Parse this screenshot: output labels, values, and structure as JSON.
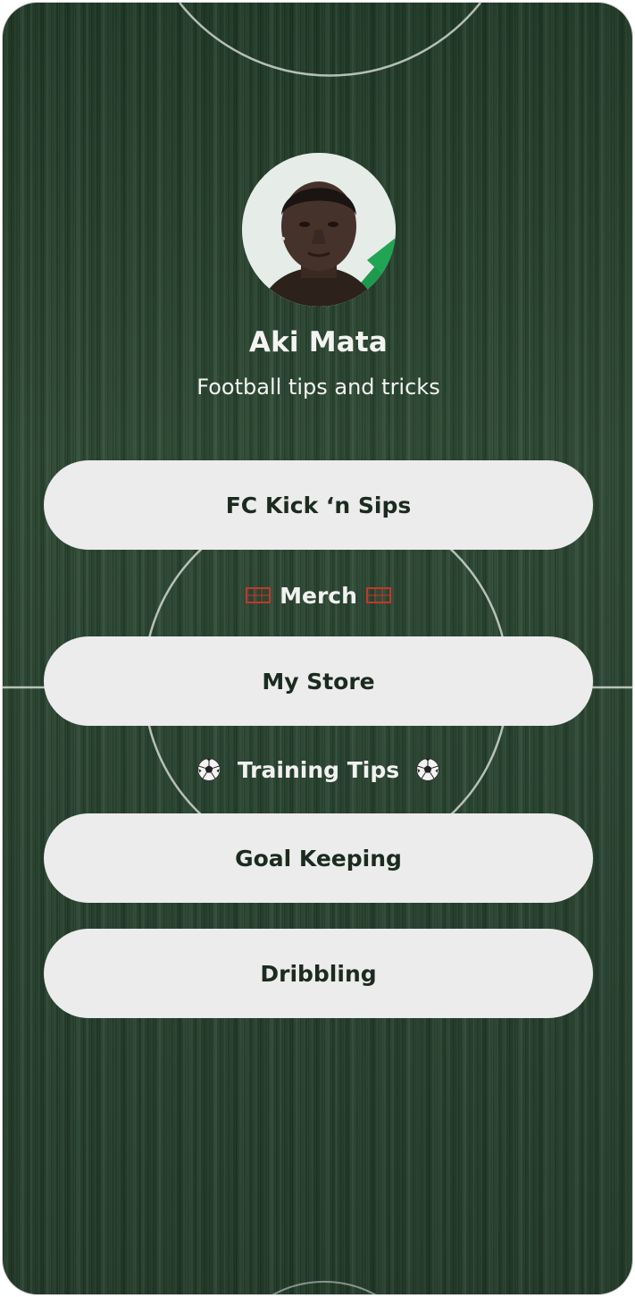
{
  "profile": {
    "name": "Aki Mata",
    "bio": "Football tips and tricks",
    "avatar_icon": "person-portrait"
  },
  "links": [
    {
      "label": "FC Kick ‘n Sips"
    },
    {
      "label": "My Store"
    },
    {
      "label": "Goal Keeping"
    },
    {
      "label": "Dribbling"
    }
  ],
  "sections": [
    {
      "title": "Merch",
      "icon": "goal-net-icon"
    },
    {
      "title": "Training Tips",
      "icon": "soccer-ball-icon"
    }
  ],
  "colors": {
    "background": "#25412b",
    "button": "#ebeceb",
    "button_text": "#1c2a20",
    "heading_text": "#f3f4f2",
    "goal_icon": "#c0392b"
  }
}
